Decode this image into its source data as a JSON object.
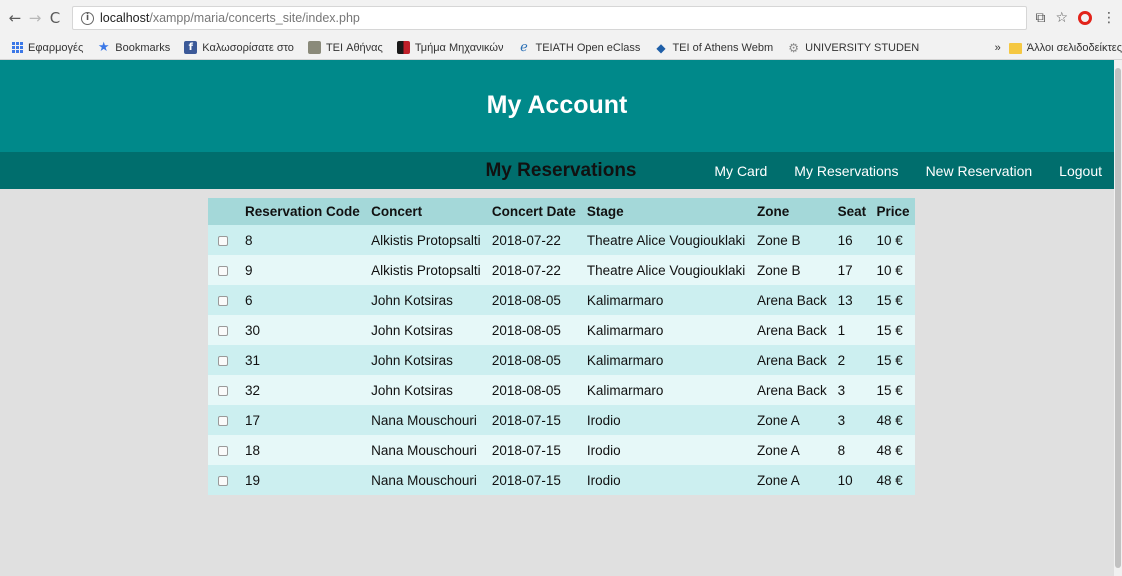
{
  "browser": {
    "url_host": "localhost",
    "url_path": "/xampp/maria/concerts_site/index.php",
    "bookmarks": [
      {
        "label": "Εφαρμογές",
        "icon": "apps-icon"
      },
      {
        "label": "Bookmarks",
        "icon": "star-icon"
      },
      {
        "label": "Καλωσορίσατε στο",
        "icon": "facebook-icon"
      },
      {
        "label": "TEI Αθήνας",
        "icon": "tei-logo-icon"
      },
      {
        "label": "Τμήμα Μηχανικών",
        "icon": "department-logo-icon"
      },
      {
        "label": "TEIATH Open eClass",
        "icon": "eclass-icon"
      },
      {
        "label": "TEI of Athens Webm",
        "icon": "webmail-icon"
      },
      {
        "label": "UNIVERSITY STUDEN",
        "icon": "university-icon"
      }
    ],
    "overflow_label": "»",
    "other_bookmarks": "Άλλοι σελιδοδείκτες"
  },
  "header": {
    "title": "My Account"
  },
  "nav": {
    "items": [
      "My Card",
      "My Reservations",
      "New Reservation",
      "Logout"
    ]
  },
  "main": {
    "section_title": "My Reservations",
    "columns": [
      "",
      "Reservation Code",
      "Concert",
      "Concert Date",
      "Stage",
      "Zone",
      "Seat",
      "Price"
    ],
    "rows": [
      [
        "8",
        "Alkistis Protopsalti",
        "2018-07-22",
        "Theatre Alice Vougiouklaki",
        "Zone B",
        "16",
        "10 €"
      ],
      [
        "9",
        "Alkistis Protopsalti",
        "2018-07-22",
        "Theatre Alice Vougiouklaki",
        "Zone B",
        "17",
        "10 €"
      ],
      [
        "6",
        "John Kotsiras",
        "2018-08-05",
        "Kalimarmaro",
        "Arena Back",
        "13",
        "15 €"
      ],
      [
        "30",
        "John Kotsiras",
        "2018-08-05",
        "Kalimarmaro",
        "Arena Back",
        "1",
        "15 €"
      ],
      [
        "31",
        "John Kotsiras",
        "2018-08-05",
        "Kalimarmaro",
        "Arena Back",
        "2",
        "15 €"
      ],
      [
        "32",
        "John Kotsiras",
        "2018-08-05",
        "Kalimarmaro",
        "Arena Back",
        "3",
        "15 €"
      ],
      [
        "17",
        "Nana Mouschouri",
        "2018-07-15",
        "Irodio",
        "Zone A",
        "3",
        "48 €"
      ],
      [
        "18",
        "Nana Mouschouri",
        "2018-07-15",
        "Irodio",
        "Zone A",
        "8",
        "48 €"
      ],
      [
        "19",
        "Nana Mouschouri",
        "2018-07-15",
        "Irodio",
        "Zone A",
        "10",
        "48 €"
      ]
    ]
  },
  "colors": {
    "header_bg": "#00898a",
    "nav_bg": "#006e6d",
    "table_header_bg": "#a4d8d9",
    "row_odd_bg": "#cceff0",
    "row_even_bg": "#e6f8f8",
    "page_bg": "#e0e0e0"
  }
}
